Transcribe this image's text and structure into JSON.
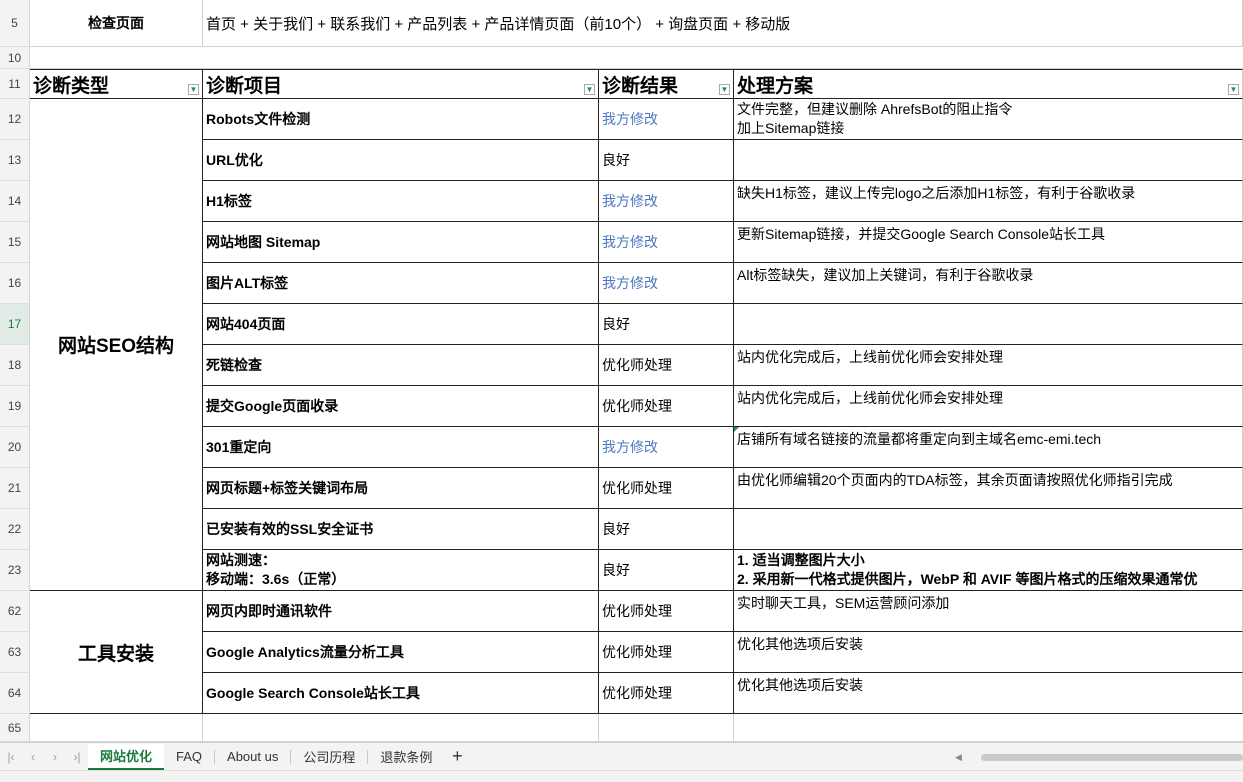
{
  "row_numbers": [
    "5",
    "10",
    "11",
    "12",
    "13",
    "14",
    "15",
    "16",
    "17",
    "18",
    "19",
    "20",
    "21",
    "22",
    "23",
    "62",
    "63",
    "64",
    "65"
  ],
  "check_page": {
    "label": "检查页面",
    "value": "首页 + 关于我们 + 联系我们 + 产品列表 + 产品详情页面（前10个） + 询盘页面 + 移动版"
  },
  "headers": {
    "type": "诊断类型",
    "item": "诊断项目",
    "result": "诊断结果",
    "solution": "处理方案"
  },
  "groups": {
    "seo": "网站SEO结构",
    "tools": "工具安装"
  },
  "rows": [
    {
      "item": "Robots文件检测",
      "result": "我方修改",
      "solution": [
        "文件完整，但建议删除 AhrefsBot的阻止指令",
        "加上Sitemap链接"
      ]
    },
    {
      "item": "URL优化",
      "result": "良好",
      "solution": []
    },
    {
      "item": "H1标签",
      "result": "我方修改",
      "solution": [
        "缺失H1标签，建议上传完logo之后添加H1标签，有利于谷歌收录"
      ]
    },
    {
      "item": "网站地图 Sitemap",
      "result": "我方修改",
      "solution": [
        "更新Sitemap链接，并提交Google Search Console站长工具"
      ]
    },
    {
      "item": "图片ALT标签",
      "result": "我方修改",
      "solution": [
        "Alt标签缺失，建议加上关键词，有利于谷歌收录"
      ]
    },
    {
      "item": "网站404页面",
      "result": "良好",
      "solution": []
    },
    {
      "item": "死链检查",
      "result": "优化师处理",
      "solution": [
        "站内优化完成后，上线前优化师会安排处理"
      ]
    },
    {
      "item": "提交Google页面收录",
      "result": "优化师处理",
      "solution": [
        "站内优化完成后，上线前优化师会安排处理"
      ]
    },
    {
      "item": "301重定向",
      "result": "我方修改",
      "solution": [
        "店铺所有域名链接的流量都将重定向到主域名emc-emi.tech"
      ]
    },
    {
      "item": "网页标题+标签关键词布局",
      "result": "优化师处理",
      "solution": [
        "由优化师编辑20个页面内的TDA标签，其余页面请按照优化师指引完成"
      ]
    },
    {
      "item": "已安装有效的SSL安全证书",
      "result": "良好",
      "solution": []
    },
    {
      "item": [
        "网站测速：",
        "移动端：3.6s（正常）"
      ],
      "result": "良好",
      "solution": [
        "1. 适当调整图片大小",
        "2. 采用新一代格式提供图片，WebP 和 AVIF 等图片格式的压缩效果通常优"
      ]
    },
    {
      "item": "网页内即时通讯软件",
      "result": "优化师处理",
      "solution": [
        "实时聊天工具，SEM运营顾问添加"
      ]
    },
    {
      "item": "Google Analytics流量分析工具",
      "result": "优化师处理",
      "solution": [
        "优化其他选项后安装"
      ]
    },
    {
      "item": "Google Search Console站长工具",
      "result": "优化师处理",
      "solution": [
        "优化其他选项后安装"
      ]
    }
  ],
  "tabs": [
    "网站优化",
    "FAQ",
    "About us",
    "公司历程",
    "退款条例"
  ],
  "active_tab": "网站优化",
  "colors": {
    "accent": "#1a7a3a",
    "link_blue": "#4a78c2",
    "filter_green": "#2e8b57"
  }
}
